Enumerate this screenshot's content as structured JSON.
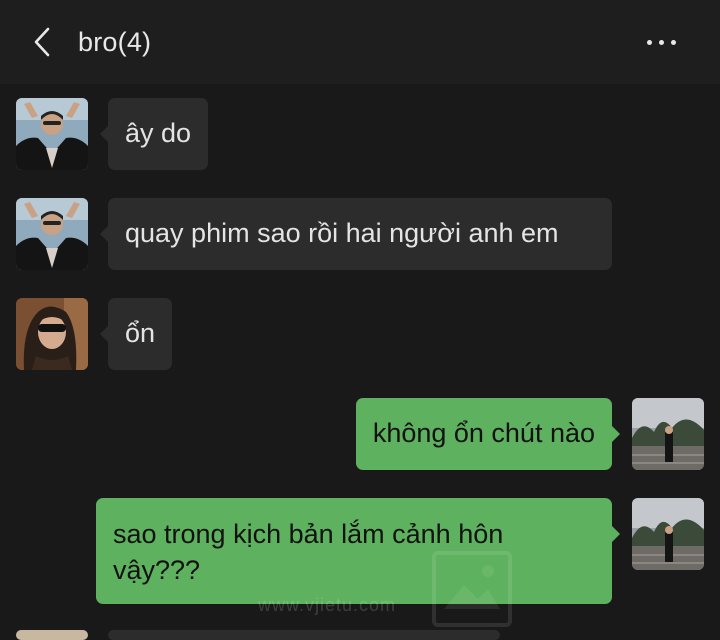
{
  "header": {
    "title": "bro(4)"
  },
  "messages": [
    {
      "side": "in",
      "text": "ây do",
      "avatar": "avatar-friend-1"
    },
    {
      "side": "in",
      "text": "quay phim sao rồi hai người anh em",
      "avatar": "avatar-friend-1"
    },
    {
      "side": "in",
      "text": "ổn",
      "avatar": "avatar-friend-2"
    },
    {
      "side": "out",
      "text": "không ổn chút nào",
      "avatar": "avatar-self"
    },
    {
      "side": "out",
      "text": "sao trong kịch bản lắm cảnh hôn vậy???",
      "avatar": "avatar-self"
    }
  ],
  "watermark": {
    "text": "www.vjietu.com"
  },
  "colors": {
    "background": "#191919",
    "header": "#1e1e1e",
    "incoming_bubble": "#2c2c2c",
    "outgoing_bubble": "#5eb15e"
  }
}
